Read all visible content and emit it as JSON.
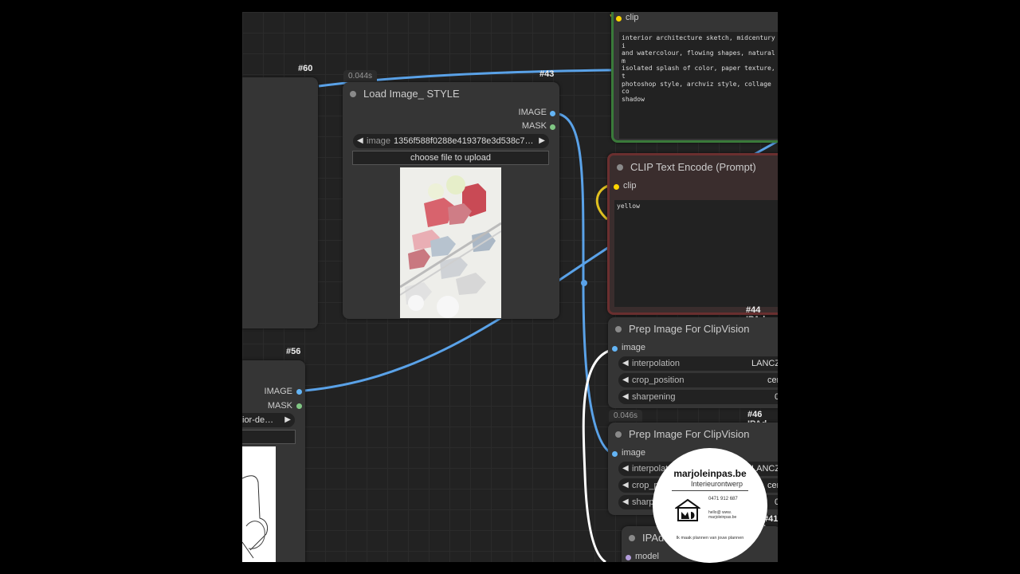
{
  "colors": {
    "canvas_bg": "#222222",
    "node_bg": "#353535",
    "wire_blue": "#5aa2e8",
    "wire_yellow": "#e0c020",
    "wire_white": "#ffffff",
    "green_node": "#3a7a3a",
    "red_node": "#6a2f2f",
    "port_image": "#64b5f6",
    "port_mask": "#81c784",
    "port_clip": "#ffd500",
    "port_model": "#b39ddb"
  },
  "nodes": {
    "n60": {
      "id_label": "#60"
    },
    "load_image": {
      "id_label": "#43",
      "timing": "0.044s",
      "title": "Load Image_ STYLE",
      "out_image": "IMAGE",
      "out_mask": "MASK",
      "widget_label": "image",
      "widget_value": "1356f588f0288e419378e3d538c7…",
      "upload_button": "choose file to upload"
    },
    "n56": {
      "id_label": "#56",
      "out_image": "IMAGE",
      "out_mask": "MASK",
      "widget_value": "ior-de…"
    },
    "green_prompt": {
      "input_clip": "clip",
      "text": "interior architecture sketch, midcentury i\nand watercolour, flowing shapes, natural m\nisolated splash of color, paper texture, t\nphotoshop style, archviz style, collage co\nshadow"
    },
    "clip_encode": {
      "title": "CLIP Text Encode (Prompt)",
      "input_clip": "clip",
      "text": "yellow"
    },
    "prep1": {
      "id_label": "#44 IPAd",
      "title": "Prep Image For ClipVision",
      "input_image": "image",
      "w1_label": "interpolation",
      "w1_value": "LANCZ",
      "w2_label": "crop_position",
      "w2_value": "cen",
      "w3_label": "sharpening",
      "w3_value": "0"
    },
    "prep2": {
      "id_label": "#46 IPAd",
      "timing": "0.046s",
      "title": "Prep Image For ClipVision",
      "input_image": "image",
      "w1_label": "interpolat",
      "w1_value": "LANCZ",
      "w2_label": "crop_p",
      "w2_value": "cen",
      "w3_label": "sharp",
      "w3_value": "0"
    },
    "ipadapter": {
      "id_label": "#41 I",
      "title": "IPAd",
      "input_model": "model"
    }
  },
  "logo": {
    "brand": "marjoleinpas.be",
    "subtitle": "Interieurontwerp",
    "phone": "0471 912 687",
    "email_line": "hello@     www.",
    "web_line": "marjoleinpas.be",
    "tagline": "Ik maak plannen van jouw plannen",
    "icon": "house-logo-icon"
  }
}
